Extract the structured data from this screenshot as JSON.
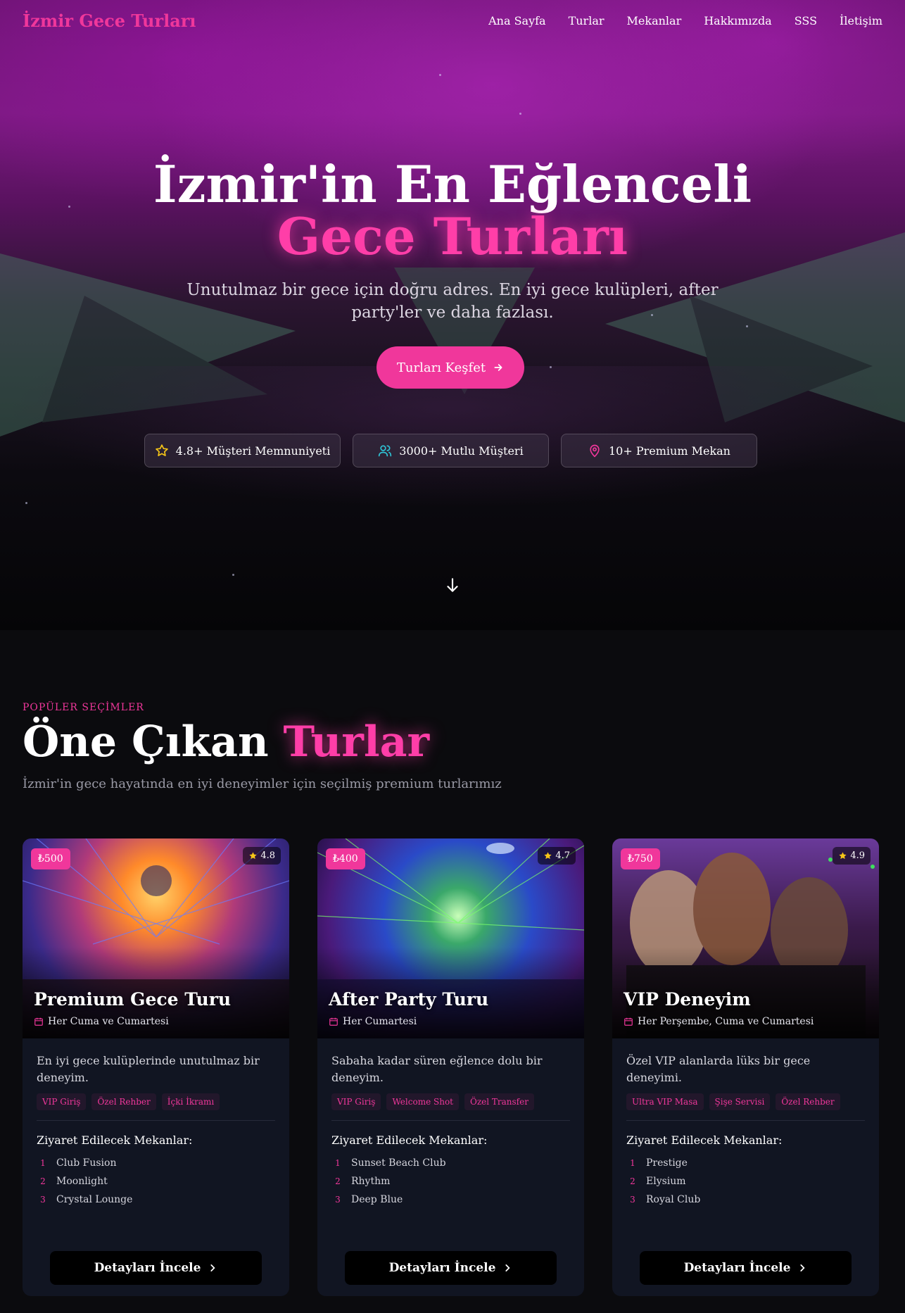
{
  "nav": {
    "brand": "İzmir Gece Turları",
    "links": [
      "Ana Sayfa",
      "Turlar",
      "Mekanlar",
      "Hakkımızda",
      "SSS",
      "İletişim"
    ]
  },
  "hero": {
    "title_line1": "İzmir'in En Eğlenceli",
    "title_line2": "Gece Turları",
    "subtitle": "Unutulmaz bir gece için doğru adres. En iyi gece kulüpleri, after party'ler ve daha fazlası.",
    "cta_label": "Turları Keşfet",
    "stats": [
      {
        "icon": "star-icon",
        "label": "4.8+ Müşteri Memnuniyeti",
        "color": "#f5c518"
      },
      {
        "icon": "users-icon",
        "label": "3000+ Mutlu Müşteri",
        "color": "#2ec4d6"
      },
      {
        "icon": "map-pin-icon",
        "label": "10+ Premium Mekan",
        "color": "#f0379b"
      }
    ]
  },
  "featured": {
    "eyebrow": "POPÜLER SEÇİMLER",
    "title_part1": "Öne Çıkan",
    "title_part2": "Turlar",
    "subtitle": "İzmir'in gece hayatında en iyi deneyimler için seçilmiş premium turlarımız",
    "venues_heading": "Ziyaret Edilecek Mekanlar:",
    "button_label": "Detayları İncele",
    "cards": [
      {
        "price": "₺500",
        "rating": "4.8",
        "title": "Premium Gece Turu",
        "schedule": "Her Cuma ve Cumartesi",
        "description": "En iyi gece kulüplerinde unutulmaz bir deneyim.",
        "tags": [
          "VIP Giriş",
          "Özel Rehber",
          "İçki İkramı"
        ],
        "venues": [
          "Club Fusion",
          "Moonlight",
          "Crystal Lounge"
        ]
      },
      {
        "price": "₺400",
        "rating": "4.7",
        "title": "After Party Turu",
        "schedule": "Her Cumartesi",
        "description": "Sabaha kadar süren eğlence dolu bir deneyim.",
        "tags": [
          "VIP Giriş",
          "Welcome Shot",
          "Özel Transfer"
        ],
        "venues": [
          "Sunset Beach Club",
          "Rhythm",
          "Deep Blue"
        ]
      },
      {
        "price": "₺750",
        "rating": "4.9",
        "title": "VIP Deneyim",
        "schedule": "Her Perşembe, Cuma ve Cumartesi",
        "description": "Özel VIP alanlarda lüks bir gece deneyimi.",
        "tags": [
          "Ultra VIP Masa",
          "Şişe Servisi",
          "Özel Rehber"
        ],
        "venues": [
          "Prestige",
          "Elysium",
          "Royal Club"
        ]
      }
    ]
  },
  "colors": {
    "accent": "#f0379b",
    "card_bg": "#111522",
    "page_bg": "#0b0b0e"
  }
}
